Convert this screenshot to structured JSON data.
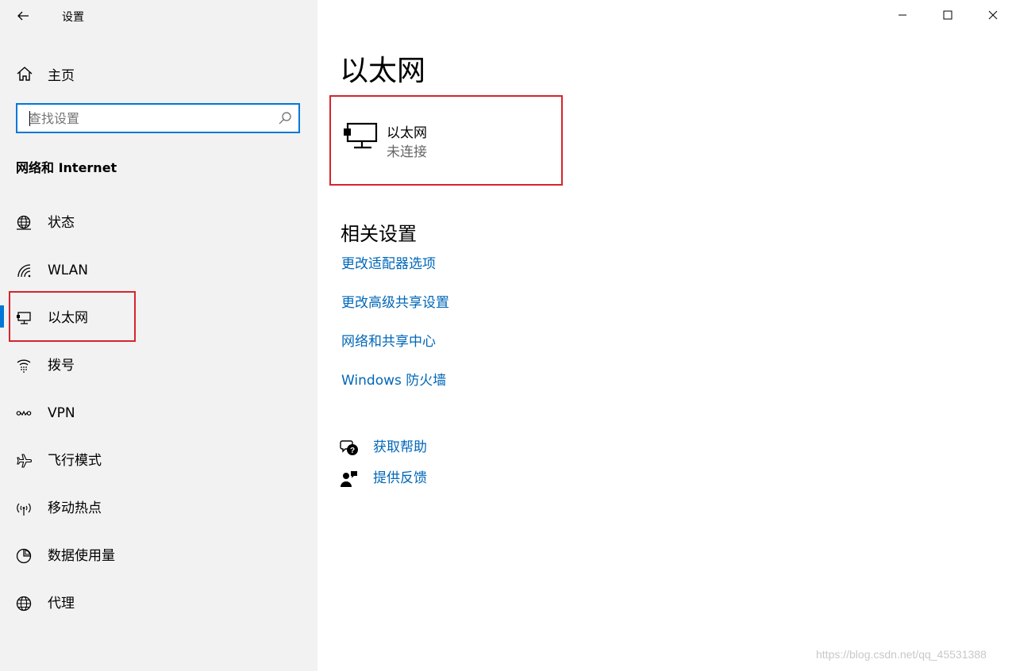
{
  "app": {
    "title": "设置"
  },
  "sidebar": {
    "home_label": "主页",
    "search_placeholder": "查找设置",
    "section_title": "网络和 Internet",
    "items": [
      {
        "label": "状态",
        "icon": "globe-status-icon"
      },
      {
        "label": "WLAN",
        "icon": "wifi-icon"
      },
      {
        "label": "以太网",
        "icon": "ethernet-icon",
        "selected": true
      },
      {
        "label": "拨号",
        "icon": "dialup-icon"
      },
      {
        "label": "VPN",
        "icon": "vpn-icon"
      },
      {
        "label": "飞行模式",
        "icon": "airplane-icon"
      },
      {
        "label": "移动热点",
        "icon": "hotspot-icon"
      },
      {
        "label": "数据使用量",
        "icon": "data-usage-icon"
      },
      {
        "label": "代理",
        "icon": "globe-icon"
      }
    ]
  },
  "main": {
    "title": "以太网",
    "ethernet_card": {
      "name": "以太网",
      "status": "未连接"
    },
    "related_title": "相关设置",
    "related_links": [
      "更改适配器选项",
      "更改高级共享设置",
      "网络和共享中心",
      "Windows 防火墙"
    ],
    "help_label": "获取帮助",
    "feedback_label": "提供反馈"
  },
  "watermark": "https://blog.csdn.net/qq_45531388",
  "colors": {
    "accent": "#0078d7",
    "link": "#0067b8",
    "highlight_box": "#d6252c",
    "sidebar_bg": "#f2f2f2"
  }
}
